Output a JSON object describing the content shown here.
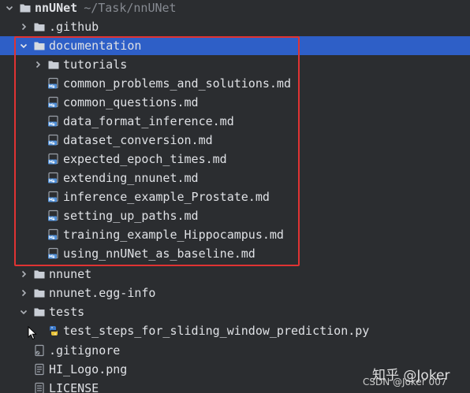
{
  "root": {
    "name": "nnUNet",
    "path": "~/Task/nnUNet"
  },
  "github": {
    "name": ".github"
  },
  "documentation": {
    "name": "documentation",
    "tutorials": {
      "name": "tutorials"
    },
    "files": [
      "common_problems_and_solutions.md",
      "common_questions.md",
      "data_format_inference.md",
      "dataset_conversion.md",
      "expected_epoch_times.md",
      "extending_nnunet.md",
      "inference_example_Prostate.md",
      "setting_up_paths.md",
      "training_example_Hippocampus.md",
      "using_nnUNet_as_baseline.md"
    ]
  },
  "nnunet_pkg": {
    "name": "nnunet"
  },
  "egg_info": {
    "name": "nnunet.egg-info"
  },
  "tests": {
    "name": "tests",
    "files": [
      "test_steps_for_sliding_window_prediction.py"
    ]
  },
  "root_files": {
    "gitignore": ".gitignore",
    "logo": "HI_Logo.png",
    "license": "LICENSE"
  },
  "watermark": {
    "main": "知乎 @Joker",
    "sub": "CSDN @Joker 007"
  },
  "colors": {
    "background": "#2b2d30",
    "selection": "#2e5fc7",
    "highlight_box": "#e03333",
    "folder": "#c9ced6",
    "md_icon": "#4f8fd8"
  },
  "icons": {
    "expanded": "chevron-down-icon",
    "collapsed": "chevron-right-icon",
    "folder": "folder-icon",
    "markdown": "markdown-file-icon",
    "python": "python-file-icon",
    "gitignore": "gitignore-file-icon",
    "image": "image-file-icon",
    "text": "text-file-icon"
  }
}
